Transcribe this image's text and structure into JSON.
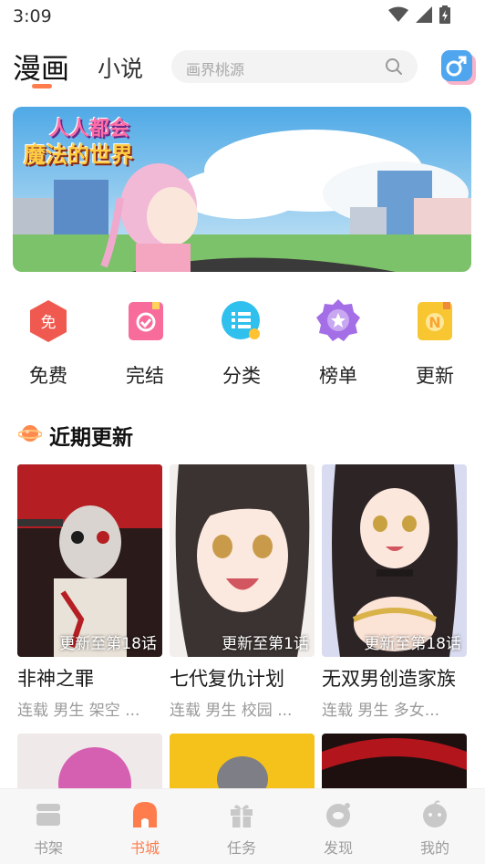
{
  "status_bar": {
    "time": "3:09"
  },
  "header": {
    "tabs": [
      {
        "label": "漫画",
        "active": true
      },
      {
        "label": "小说",
        "active": false
      }
    ],
    "search": {
      "placeholder": "画界桃源"
    },
    "gender_icon": "male-icon"
  },
  "banner": {
    "title_line1": "人人都会",
    "title_line2": "魔法的世界"
  },
  "categories": [
    {
      "label": "免费",
      "icon": "free-icon",
      "icon_text": "免",
      "color": "#f0594f"
    },
    {
      "label": "完结",
      "icon": "completed-icon",
      "color": "#f76c9b"
    },
    {
      "label": "分类",
      "icon": "category-list-icon",
      "color": "#2fc0ee"
    },
    {
      "label": "榜单",
      "icon": "ranking-badge-icon",
      "color": "#a46ee6"
    },
    {
      "label": "更新",
      "icon": "update-icon",
      "icon_text": "N",
      "color": "#f7c631"
    }
  ],
  "section": {
    "title": "近期更新",
    "icon": "planet-icon"
  },
  "comics": [
    {
      "title": "非神之罪",
      "badge": "更新至第18话",
      "tags": "连载 男生 架空 ..."
    },
    {
      "title": "七代复仇计划",
      "badge": "更新至第1话",
      "tags": "连载 男生 校园 ..."
    },
    {
      "title": "无双男创造家族",
      "badge": "更新至第18话",
      "tags": "连载 男生 多女..."
    }
  ],
  "bottom_nav": [
    {
      "label": "书架",
      "icon": "bookshelf-icon",
      "active": false
    },
    {
      "label": "书城",
      "icon": "bookstore-icon",
      "active": true
    },
    {
      "label": "任务",
      "icon": "gift-icon",
      "active": false
    },
    {
      "label": "发现",
      "icon": "discover-icon",
      "active": false
    },
    {
      "label": "我的",
      "icon": "profile-icon",
      "active": false
    }
  ],
  "colors": {
    "accent": "#ff7d4d",
    "nav_inactive": "#9c9c9c",
    "tag_text": "#9a9a9a"
  }
}
